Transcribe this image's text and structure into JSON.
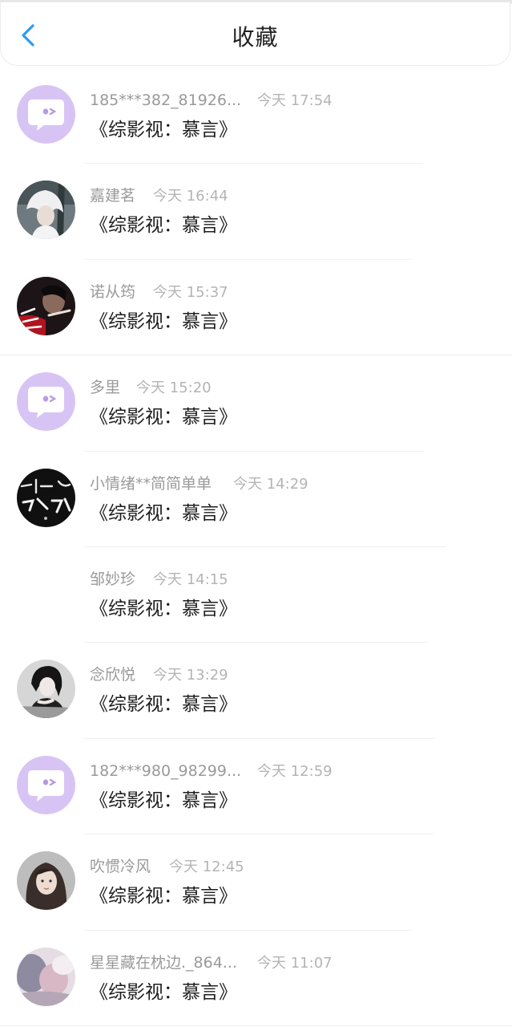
{
  "header": {
    "title": "收藏",
    "back_icon": "chevron-left-icon",
    "accent_color": "#2a9df4"
  },
  "items": [
    {
      "name": "185***382_81926...",
      "time": "今天 17:54",
      "book": "《综影视：慕言》",
      "avatar": "default-chat-bubble-avatar"
    },
    {
      "name": "嘉建茗",
      "time": "今天 16:44",
      "book": "《综影视：慕言》",
      "avatar": "photo-avatar-white-hair"
    },
    {
      "name": "诺从筠",
      "time": "今天 15:37",
      "book": "《综影视：慕言》",
      "avatar": "photo-avatar-red-graphic"
    },
    {
      "name": "多里",
      "time": "今天 15:20",
      "book": "《综影视：慕言》",
      "avatar": "default-chat-bubble-avatar"
    },
    {
      "name": "小情绪**简简单单",
      "time": "今天 14:29",
      "book": "《综影视：慕言》",
      "avatar": "photo-avatar-dark-calligraphy"
    },
    {
      "name": "邹妙珍",
      "time": "今天 14:15",
      "book": "《综影视：慕言》",
      "avatar": "none"
    },
    {
      "name": "念欣悦",
      "time": "今天 13:29",
      "book": "《综影视：慕言》",
      "avatar": "photo-avatar-bw-portrait"
    },
    {
      "name": "182***980_98299...",
      "time": "今天 12:59",
      "book": "《综影视：慕言》",
      "avatar": "default-chat-bubble-avatar"
    },
    {
      "name": "吹惯冷风",
      "time": "今天 12:45",
      "book": "《综影视：慕言》",
      "avatar": "photo-avatar-girl-portrait"
    },
    {
      "name": "星星藏在枕边._864...",
      "time": "今天 11:07",
      "book": "《综影视：慕言》",
      "avatar": "photo-avatar-blurred"
    }
  ],
  "colors": {
    "default_avatar_bg": "#d8c4f4",
    "name_text": "#9a9a9a",
    "time_text": "#b4b4b4",
    "book_text": "#1e1e1e"
  }
}
